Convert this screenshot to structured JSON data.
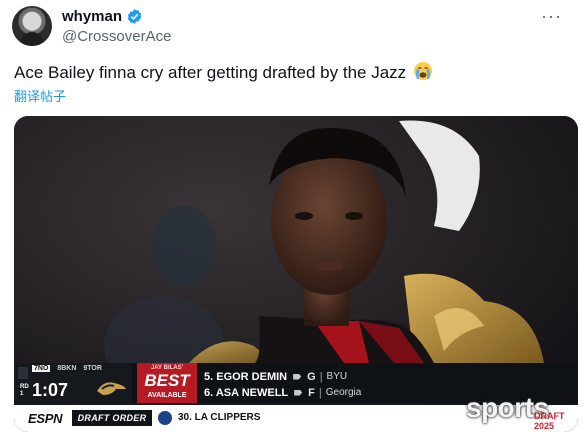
{
  "tweet": {
    "display_name": "whyman",
    "handle": "@CrossoverAce",
    "text": "Ace Bailey finna cry after getting drafted by the Jazz",
    "translate_label": "翻译帖子"
  },
  "broadcast": {
    "teams": [
      "7NO",
      "8BKN",
      "9TOR"
    ],
    "round_label": [
      "RD",
      "1"
    ],
    "clock": "1:07",
    "best_top": "JAY BILAS'",
    "best_main": "BEST",
    "best_sub": "AVAILABLE",
    "picks": [
      {
        "line": "5. EGOR DEMIN",
        "pos": "G",
        "school": "BYU"
      },
      {
        "line": "6. ASA NEWELL",
        "pos": "F",
        "school": "Georgia"
      }
    ],
    "espn_logo": "ESPN",
    "draft_order_label": "DRAFT ORDER",
    "next_pick": "30. LA CLIPPERS",
    "watermark": "sports",
    "draft_badge": "DRAFT 2025"
  },
  "colors": {
    "accent_blue": "#1d9bf0",
    "best_red": "#b61a23",
    "verified": "#1d9bf0"
  }
}
